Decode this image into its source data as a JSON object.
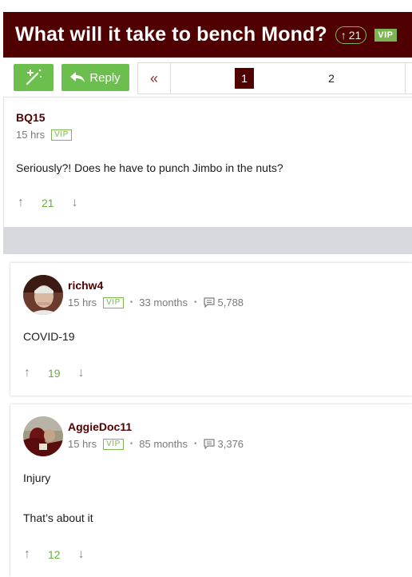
{
  "thread": {
    "title": "What will it take to bench Mond?",
    "vote_count": "21",
    "vip_label": "VIP"
  },
  "toolbar": {
    "reply_label": "Reply",
    "pages": [
      "1",
      "2"
    ],
    "first_page_glyph": "«"
  },
  "posts": [
    {
      "author": "BQ15",
      "time": "15 hrs",
      "vip": "VIP",
      "body": "Seriously?! Does he have to punch Jimbo in the nuts?",
      "votes": "21"
    },
    {
      "author": "richw4",
      "time": "15 hrs",
      "vip": "VIP",
      "tenure": "33 months",
      "post_count": "5,788",
      "body": "COVID-19",
      "votes": "19"
    },
    {
      "author": "AggieDoc11",
      "time": "15 hrs",
      "vip": "VIP",
      "tenure": "85 months",
      "post_count": "3,376",
      "body_lines": [
        "Injury",
        "That’s about it"
      ],
      "votes": "12"
    }
  ],
  "icons": {
    "up": "↑",
    "down": "↓"
  },
  "colors": {
    "maroon": "#500000",
    "green": "#6cbf4f",
    "vote_green": "#6cae3f",
    "band_gray": "#d7d9de"
  }
}
